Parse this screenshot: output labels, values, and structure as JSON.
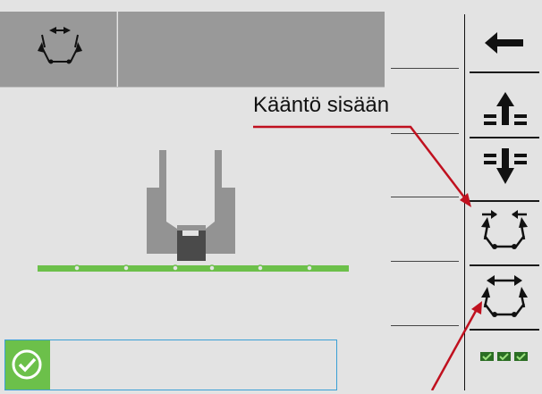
{
  "header": {
    "mode_icon": "boom-fold-outward-icon",
    "mode_text": ""
  },
  "callout": {
    "label": "Kääntö sisään",
    "arrow_color": "#c0111f"
  },
  "sidebar": {
    "buttons": [
      {
        "name": "back-button",
        "icon": "arrow-left-icon"
      },
      {
        "name": "boom-raise-button",
        "icon": "boom-raise-icon"
      },
      {
        "name": "boom-lower-button",
        "icon": "boom-lower-icon"
      },
      {
        "name": "boom-fold-in-button",
        "icon": "boom-fold-inward-icon"
      },
      {
        "name": "boom-fold-out-button",
        "icon": "boom-fold-outward-icon"
      },
      {
        "name": "sections-button",
        "icon": "sections-check-icon"
      }
    ]
  },
  "status": {
    "icon": "checkmark-circle-icon",
    "text": "",
    "ok_color": "#6cc04a",
    "border_color": "#3a9fd5"
  },
  "colors": {
    "background": "#e3e3e3",
    "header_fill": "#999999",
    "boom_bar": "#6cc04a",
    "machine_fill": "#939393",
    "machine_dark": "#4a4a4a"
  }
}
